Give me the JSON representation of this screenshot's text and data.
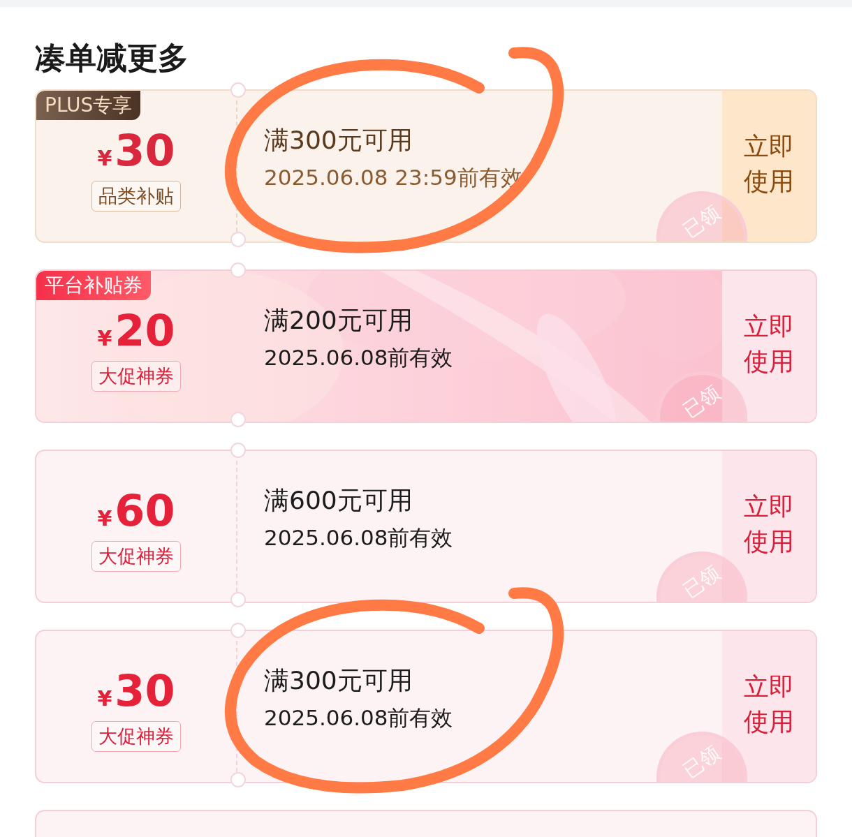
{
  "section_title": "凑单减更多",
  "coupons": [
    {
      "kind": "plus",
      "badge": "PLUS专享",
      "currency": "¥",
      "amount": "30",
      "tag": "品类补贴",
      "condition": "满300元可用",
      "validity": "2025.06.08 23:59前有效",
      "action": "立即使用",
      "stamp": "已领",
      "circled": true
    },
    {
      "kind": "platform",
      "badge": "平台补贴券",
      "currency": "¥",
      "amount": "20",
      "tag": "大促神券",
      "condition": "满200元可用",
      "validity": "2025.06.08前有效",
      "action": "立即使用",
      "stamp": "已领",
      "circled": false
    },
    {
      "kind": "promo",
      "currency": "¥",
      "amount": "60",
      "tag": "大促神券",
      "condition": "满600元可用",
      "validity": "2025.06.08前有效",
      "action": "立即使用",
      "stamp": "已领",
      "circled": false
    },
    {
      "kind": "promo",
      "currency": "¥",
      "amount": "30",
      "tag": "大促神券",
      "condition": "满300元可用",
      "validity": "2025.06.08前有效",
      "action": "立即使用",
      "stamp": "已领",
      "circled": true
    }
  ],
  "more_below": true
}
